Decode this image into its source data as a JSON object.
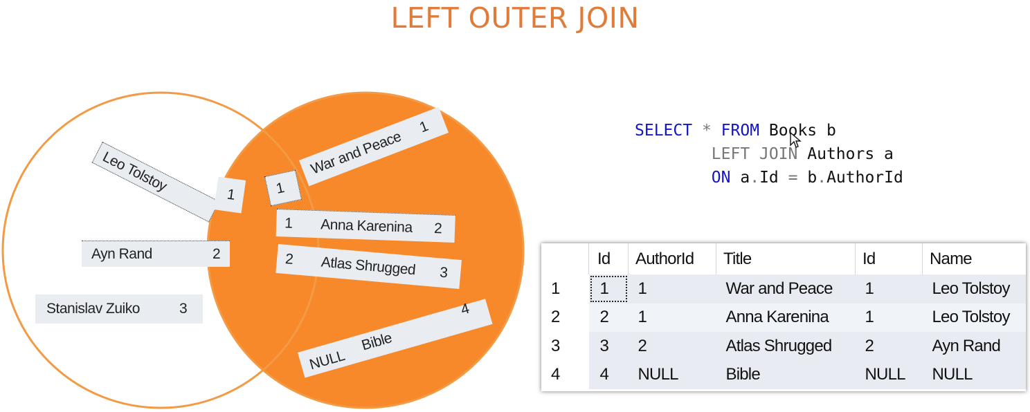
{
  "title": "LEFT OUTER JOIN",
  "colors": {
    "title": "#e07b39",
    "circle_outline": "#f39a45",
    "circle_fill": "#f7892a",
    "keyword": "#1515c8"
  },
  "venn": {
    "left_items": [
      {
        "name": "Leo Tolstoy",
        "id": "1"
      },
      {
        "name": "Ayn Rand",
        "id": "2"
      },
      {
        "name": "Stanislav Zuiko",
        "id": "3"
      }
    ],
    "right_items": [
      {
        "author_id": "1",
        "title": "War and Peace",
        "id": "1"
      },
      {
        "author_id": "1",
        "title": "Anna Karenina",
        "id": "2"
      },
      {
        "author_id": "2",
        "title": "Atlas Shrugged",
        "id": "3"
      },
      {
        "author_id": "NULL",
        "title": "Bible",
        "id": "4"
      }
    ]
  },
  "sql": {
    "select": "SELECT",
    "star": "*",
    "from": "FROM",
    "table1": "Books b",
    "left_join": "LEFT JOIN",
    "table2": "Authors a",
    "on": "ON",
    "cond_a": "a",
    "cond_dot1": ".",
    "cond_mid": "Id",
    "cond_eq": "=",
    "cond_b": "b",
    "cond_dot2": ".",
    "cond_end": "AuthorId"
  },
  "result": {
    "columns": [
      "",
      "Id",
      "AuthorId",
      "Title",
      "Id",
      "Name"
    ],
    "rows": [
      [
        "1",
        "1",
        "1",
        "War and Peace",
        "1",
        "Leo Tolstoy"
      ],
      [
        "2",
        "2",
        "1",
        "Anna Karenina",
        "1",
        "Leo Tolstoy"
      ],
      [
        "3",
        "3",
        "2",
        "Atlas Shrugged",
        "2",
        "Ayn Rand"
      ],
      [
        "4",
        "4",
        "NULL",
        "Bible",
        "NULL",
        "NULL"
      ]
    ]
  }
}
